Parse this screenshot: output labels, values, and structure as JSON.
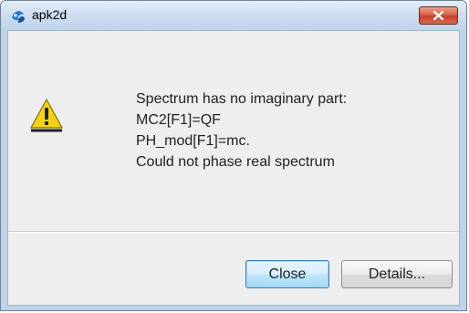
{
  "window": {
    "title": "apk2d",
    "title_icon": "apk2d-app-icon",
    "close_icon": "close-icon"
  },
  "dialog": {
    "icon": "warning-icon",
    "message_lines": [
      "Spectrum has no imaginary part:",
      "MC2[F1]=QF",
      "PH_mod[F1]=mc.",
      "Could not phase real spectrum"
    ],
    "buttons": {
      "close_label": "Close",
      "details_label": "Details..."
    }
  },
  "colors": {
    "titlebar": "#bfd3ea",
    "close_button": "#c4422c",
    "warning_yellow": "#f5d21a",
    "dialog_background": "#eeeeee"
  }
}
